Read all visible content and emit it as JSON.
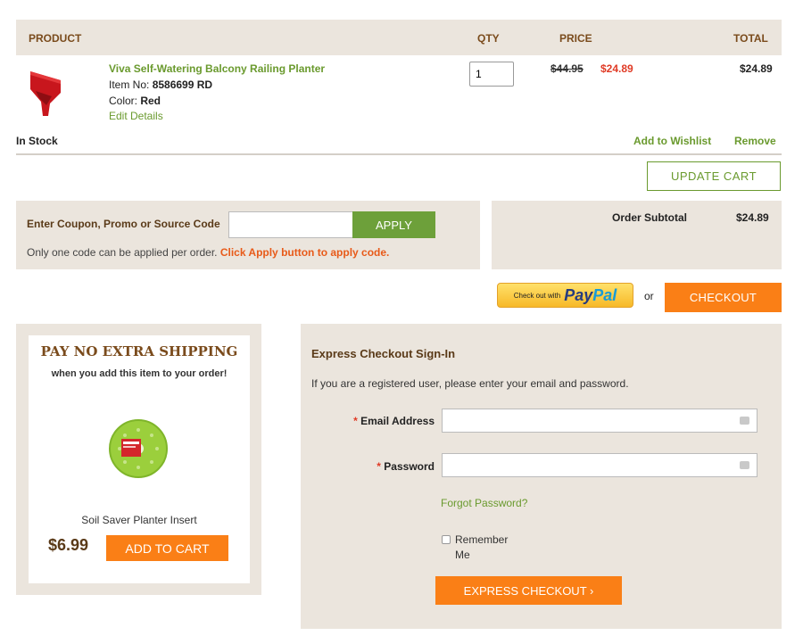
{
  "cart_header": {
    "product": "PRODUCT",
    "qty": "QTY",
    "price": "PRICE",
    "total": "TOTAL"
  },
  "item": {
    "name": "Viva Self-Watering Balcony Railing Planter",
    "item_no_label": "Item No: ",
    "item_no": "8586699 RD",
    "color_label": "Color: ",
    "color": "Red",
    "edit_link": "Edit Details",
    "qty": "1",
    "old_price": "$44.95",
    "new_price": "$24.89",
    "total": "$24.89",
    "stock_status": "In Stock",
    "wishlist_link": "Add to Wishlist",
    "remove_link": "Remove"
  },
  "update_cart_button": "UPDATE CART",
  "coupon": {
    "label": "Enter Coupon, Promo or Source Code",
    "input_value": "",
    "apply_button": "APPLY",
    "note_plain": "Only one code can be applied per order. ",
    "note_highlight": "Click Apply button to apply code."
  },
  "subtotal": {
    "label": "Order Subtotal",
    "value": "$24.89"
  },
  "checkout": {
    "paypal_small": "Check out with",
    "paypal_pay": "Pay",
    "paypal_pal": "Pal",
    "or_text": "or",
    "checkout_button": "CHECKOUT"
  },
  "promo": {
    "title": "PAY NO EXTRA SHIPPING",
    "subtitle": "when you add this item to your order!",
    "product_name": "Soil Saver Planter Insert",
    "price": "$6.99",
    "add_button": "ADD TO CART"
  },
  "express": {
    "title": "Express Checkout Sign-In",
    "description": "If you are a registered user, please enter your email and password.",
    "required_mark": "*",
    "email_label": "Email Address",
    "password_label": "Password",
    "email_value": "",
    "password_value": "",
    "forgot_link": "Forgot Password?",
    "remember_label": "Remember Me",
    "submit_button": "EXPRESS CHECKOUT ›"
  },
  "colors": {
    "accent_orange": "#fa7f16",
    "accent_green": "#6a9a2e",
    "sale_red": "#e03b26",
    "panel_beige": "#ebe5dd",
    "heading_brown": "#7a4b1c"
  },
  "icons": [
    "planter-product-image",
    "planter-insert-image",
    "autofill-key-icon",
    "paypal-logo",
    "chevron-right-icon"
  ]
}
